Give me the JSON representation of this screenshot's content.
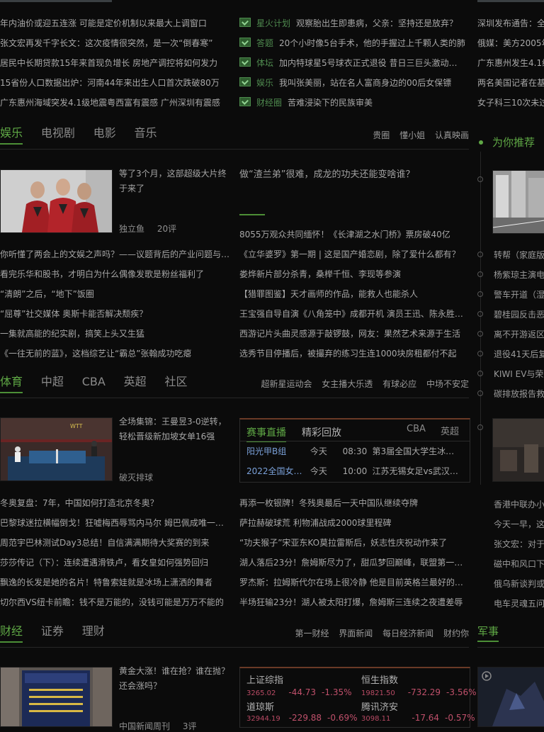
{
  "top_news_left": [
    "年内油价或迎五连涨 可能是定价机制以来最大上调窗口",
    "张文宏再发千字长文：这次疫情很突然，是一次“倒春寒”",
    "居民中长期贷款15年来首现负增长 房地产调控将如何发力",
    "15省份人口数据出炉：河南44年来出生人口首次跌破80万",
    "广东惠州海域突发4.1级地震粤西富有震感 广州深圳有震感"
  ],
  "top_news_mid": [
    {
      "tag": "星火计划",
      "text": "观察胎出生即患病，父亲：坚持还是放弃？"
    },
    {
      "tag": "答题",
      "text": "20个小时像5台手术，他的手握过上千颗人类的肺"
    },
    {
      "tag": "体坛",
      "text": "加内特球星5号球衣正式退役 昔日三巨头激动…"
    },
    {
      "tag": "娱乐",
      "text": "我叫张美丽，站在名人富商身边的00后女保镖"
    },
    {
      "tag": "财经圈",
      "text": "苦难浸染下的民族审美"
    }
  ],
  "top_news_right": [
    "深圳发布通告：全",
    "俄媒：美方2005年",
    "广东惠州发生4.1级",
    "两名美国记者在基",
    "女子科三10次未过"
  ],
  "ent": {
    "tabs": [
      "娱乐",
      "电视剧",
      "电影",
      "音乐"
    ],
    "links": [
      "贵圈",
      "懂小姐",
      "认真映画"
    ],
    "feature_title": "等了3个月，这部超级大片终于来了",
    "feature_source": "独立鱼",
    "feature_comments": "20评",
    "big_headline": "做“渣兰弟”很难，成龙的功夫还能变啥谁？",
    "left_list": [
      "你听懂了两会上的文娱之声吗？——议题背后的产业问题与…",
      "看完乐华和股书，才明白为什么偶像发歌是粉丝福利了",
      "“清朗”之后，“地下”饭圈",
      "“屈尊”社交媒体 奥斯卡能否解决颓疾？",
      "一集就高能的纪实剧，搞笑上头又生猛",
      "《一往无前的蓝》，这档综艺让“霸总”张翰成功吃瘪"
    ],
    "right_list": [
      "8055万观众共同缅怀！《长津湖之水门桥》票房破40亿",
      "《立华婆罗》第一期 | 这是国产婚恋剧，除了爱什么都有？",
      "娄烨新片部分杀青，桑榉千恒、李现等参演",
      "【猎罪图鉴】天才画师的作品，能救人也能杀人",
      "王宝强自导自演《八角笼中》成都开机 演员王迅、陈永胜…",
      "西游记片头曲灵感源于敲锣鼓，网友：果然艺术来源于生活",
      "选秀节目停播后，被撮弃的练习生连1000块房租都付不起"
    ]
  },
  "sports": {
    "tabs": [
      "体育",
      "中超",
      "CBA",
      "英超",
      "社区"
    ],
    "links": [
      "超新星运动会",
      "女主播大乐透",
      "有球必应",
      "中场不安定"
    ],
    "feature_title": "全场集锦：王曼昱3-0逆转，轻松晋级新加坡女单16强",
    "feature_source": "破灭排球",
    "live_tabs": [
      "赛事直播",
      "精彩回放",
      "CBA",
      "英超"
    ],
    "live_rows": [
      {
        "event": "阳光甲B组",
        "day": "今天",
        "time": "08:30",
        "match": "第3届全国大学生冰…"
      },
      {
        "event": "2022全国女…",
        "day": "今天",
        "time": "10:00",
        "match": "江苏无锡女足vs武汉…"
      }
    ],
    "left_list": [
      "冬奥复盘：7年，中国如何打造北京冬奥？",
      "巴黎球迷拉横幅倒戈！狂嘘梅西辱骂内马尔 姆巴佩成唯一…",
      "周范宇巴林测试Day3总结！自信满满期待大奖赛的到来",
      "莎莎传记（下）：连续遭遇滑铁卢，看女皇如何强势回归",
      "飘逸的长发是她的名片！特鲁索娃就是冰场上潇洒的舞者",
      "切尔西VS纽卡前瞻：钱不是万能的，没钱可能是万万不能的"
    ],
    "right_list": [
      "再添一枚银牌！冬残奥最后一天中国队继续夺牌",
      "萨拉赫破球荒 利物浦战成2000球里程碑",
      "“功夫猴子”宋亚东KO莫拉雷斯后，妖志性庆祝动作来了",
      "湖人落后23分！詹姆斯尽力了，甜瓜梦回巅峰，联盟第一太狠",
      "罗杰斯：拉姆斯代尔在场上很冷静 他是目前英格兰最好的…",
      "半场狂输23分！湖人被太阳打爆，詹姆斯三连续之夜遭差辱"
    ]
  },
  "finance": {
    "tabs": [
      "财经",
      "证券",
      "理财"
    ],
    "links": [
      "第一财经",
      "界面新闻",
      "每日经济新闻",
      "财约你"
    ],
    "feature_title": "黄金大涨！谁在抢？谁在抛？还会涨吗？",
    "feature_source": "中国新闻周刊",
    "feature_comments": "3评",
    "stocks": [
      {
        "name": "上证综指",
        "price": "3265.02",
        "change": "-44.73",
        "pct": "-1.35%"
      },
      {
        "name": "恒生指数",
        "price": "19821.50",
        "change": "-732.29",
        "pct": "-3.56%"
      },
      {
        "name": "道琼斯",
        "price": "32944.19",
        "change": "-229.88",
        "pct": "-0.69%"
      },
      {
        "name": "腾讯济安",
        "price": "3098.11",
        "change": "-17.64",
        "pct": "-0.57%"
      }
    ]
  },
  "sidebar": {
    "title": "为你推荐",
    "items": [
      "转帮（家庭版",
      "杨紫琼主演电",
      "警车开道（湿",
      "碧桂园反击恶",
      "离不开游返区",
      "退役41天后复",
      "KIWI EV与荣",
      "碳排放报告救"
    ],
    "items2": [
      "香港中联办小",
      "今天一早，这",
      "张文宏：对于",
      "磁中和风口下",
      "俄乌新谈判或",
      "电车灵魂五问"
    ],
    "military_label": "军事"
  },
  "colors": {
    "accent": "#5fa845",
    "down": "#c0506b",
    "background": "#0b0b0b"
  }
}
